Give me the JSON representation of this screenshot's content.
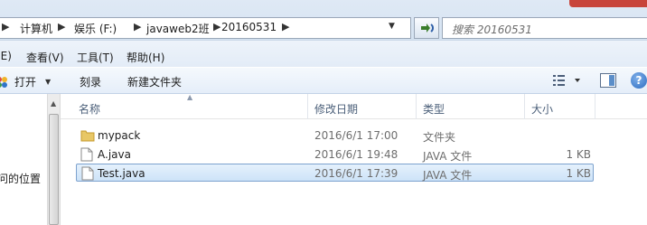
{
  "address": {
    "crumbs": [
      "计算机",
      "娱乐 (F:)",
      "javaweb2班",
      "20160531"
    ],
    "search_placeholder": "搜索 20160531"
  },
  "menu": {
    "items": [
      "(E)",
      "查看(V)",
      "工具(T)",
      "帮助(H)"
    ]
  },
  "toolbar": {
    "open_label": "打开",
    "burn_label": "刻录",
    "new_folder_label": "新建文件夹"
  },
  "nav": {
    "visible_item": "问的位置"
  },
  "columns": {
    "name": "名称",
    "modified": "修改日期",
    "type": "类型",
    "size": "大小"
  },
  "files": [
    {
      "name": "mypack",
      "modified": "2016/6/1 17:00",
      "type": "文件夹",
      "size": "",
      "icon": "folder-icon",
      "selected": false
    },
    {
      "name": "A.java",
      "modified": "2016/6/1 19:48",
      "type": "JAVA 文件",
      "size": "1 KB",
      "icon": "file-icon",
      "selected": false
    },
    {
      "name": "Test.java",
      "modified": "2016/6/1 17:39",
      "type": "JAVA 文件",
      "size": "1 KB",
      "icon": "file-icon",
      "selected": true
    }
  ],
  "colors": {
    "selection_fill": "#cde3f8",
    "selection_border": "#7da2ce",
    "folder": "#e8c766",
    "header_text": "#4c607a"
  }
}
